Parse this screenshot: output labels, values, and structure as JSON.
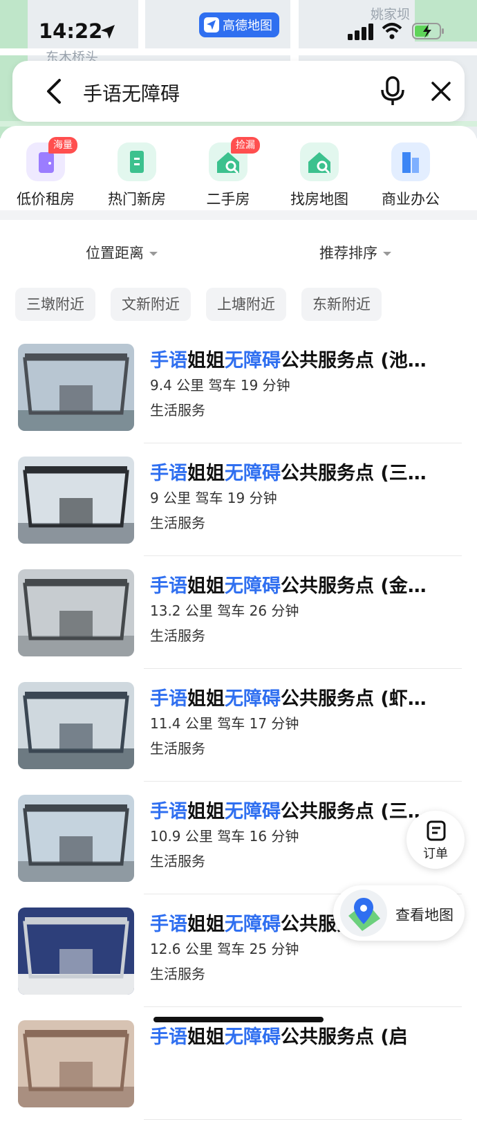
{
  "status": {
    "time": "14:22",
    "app_name": "高德地图"
  },
  "map_labels": [
    "姚家坝",
    "东木桥头"
  ],
  "search": {
    "query": "手语无障碍"
  },
  "categories": [
    {
      "label": "低价租房",
      "tag": "海量",
      "color": "#a18cff"
    },
    {
      "label": "热门新房",
      "tag": "",
      "color": "#39c58a"
    },
    {
      "label": "二手房",
      "tag": "捡漏",
      "color": "#38c08a"
    },
    {
      "label": "找房地图",
      "tag": "",
      "color": "#3cc18e"
    },
    {
      "label": "商业办公",
      "tag": "",
      "color": "#3d86f5"
    }
  ],
  "filters": {
    "distance": "位置距离",
    "sort": "推荐排序"
  },
  "chips": [
    "三墩附近",
    "文新附近",
    "上塘附近",
    "东新附近"
  ],
  "results": [
    {
      "hl1": "手语",
      "mid": "姐姐",
      "hl2": "无障碍",
      "rest": "公共服务点 (池…",
      "distance": "9.4 公里  驾车 19 分钟",
      "category": "生活服务"
    },
    {
      "hl1": "手语",
      "mid": "姐姐",
      "hl2": "无障碍",
      "rest": "公共服务点 (三…",
      "distance": "9 公里  驾车 19 分钟",
      "category": "生活服务"
    },
    {
      "hl1": "手语",
      "mid": "姐姐",
      "hl2": "无障碍",
      "rest": "公共服务点 (金…",
      "distance": "13.2 公里  驾车 26 分钟",
      "category": "生活服务"
    },
    {
      "hl1": "手语",
      "mid": "姐姐",
      "hl2": "无障碍",
      "rest": "公共服务点 (虾…",
      "distance": "11.4 公里  驾车 17 分钟",
      "category": "生活服务"
    },
    {
      "hl1": "手语",
      "mid": "姐姐",
      "hl2": "无障碍",
      "rest": "公共服务点 (三…",
      "distance": "10.9 公里  驾车 16 分钟",
      "category": "生活服务"
    },
    {
      "hl1": "手语",
      "mid": "姐姐",
      "hl2": "无障碍",
      "rest": "公共服务点 (…",
      "distance": "12.6 公里  驾车 25 分钟",
      "category": "生活服务"
    },
    {
      "hl1": "手语",
      "mid": "姐姐",
      "hl2": "无障碍",
      "rest": "公共服务点 (启",
      "distance": "",
      "category": ""
    }
  ],
  "floating": {
    "order_label": "订单",
    "map_label": "查看地图"
  }
}
